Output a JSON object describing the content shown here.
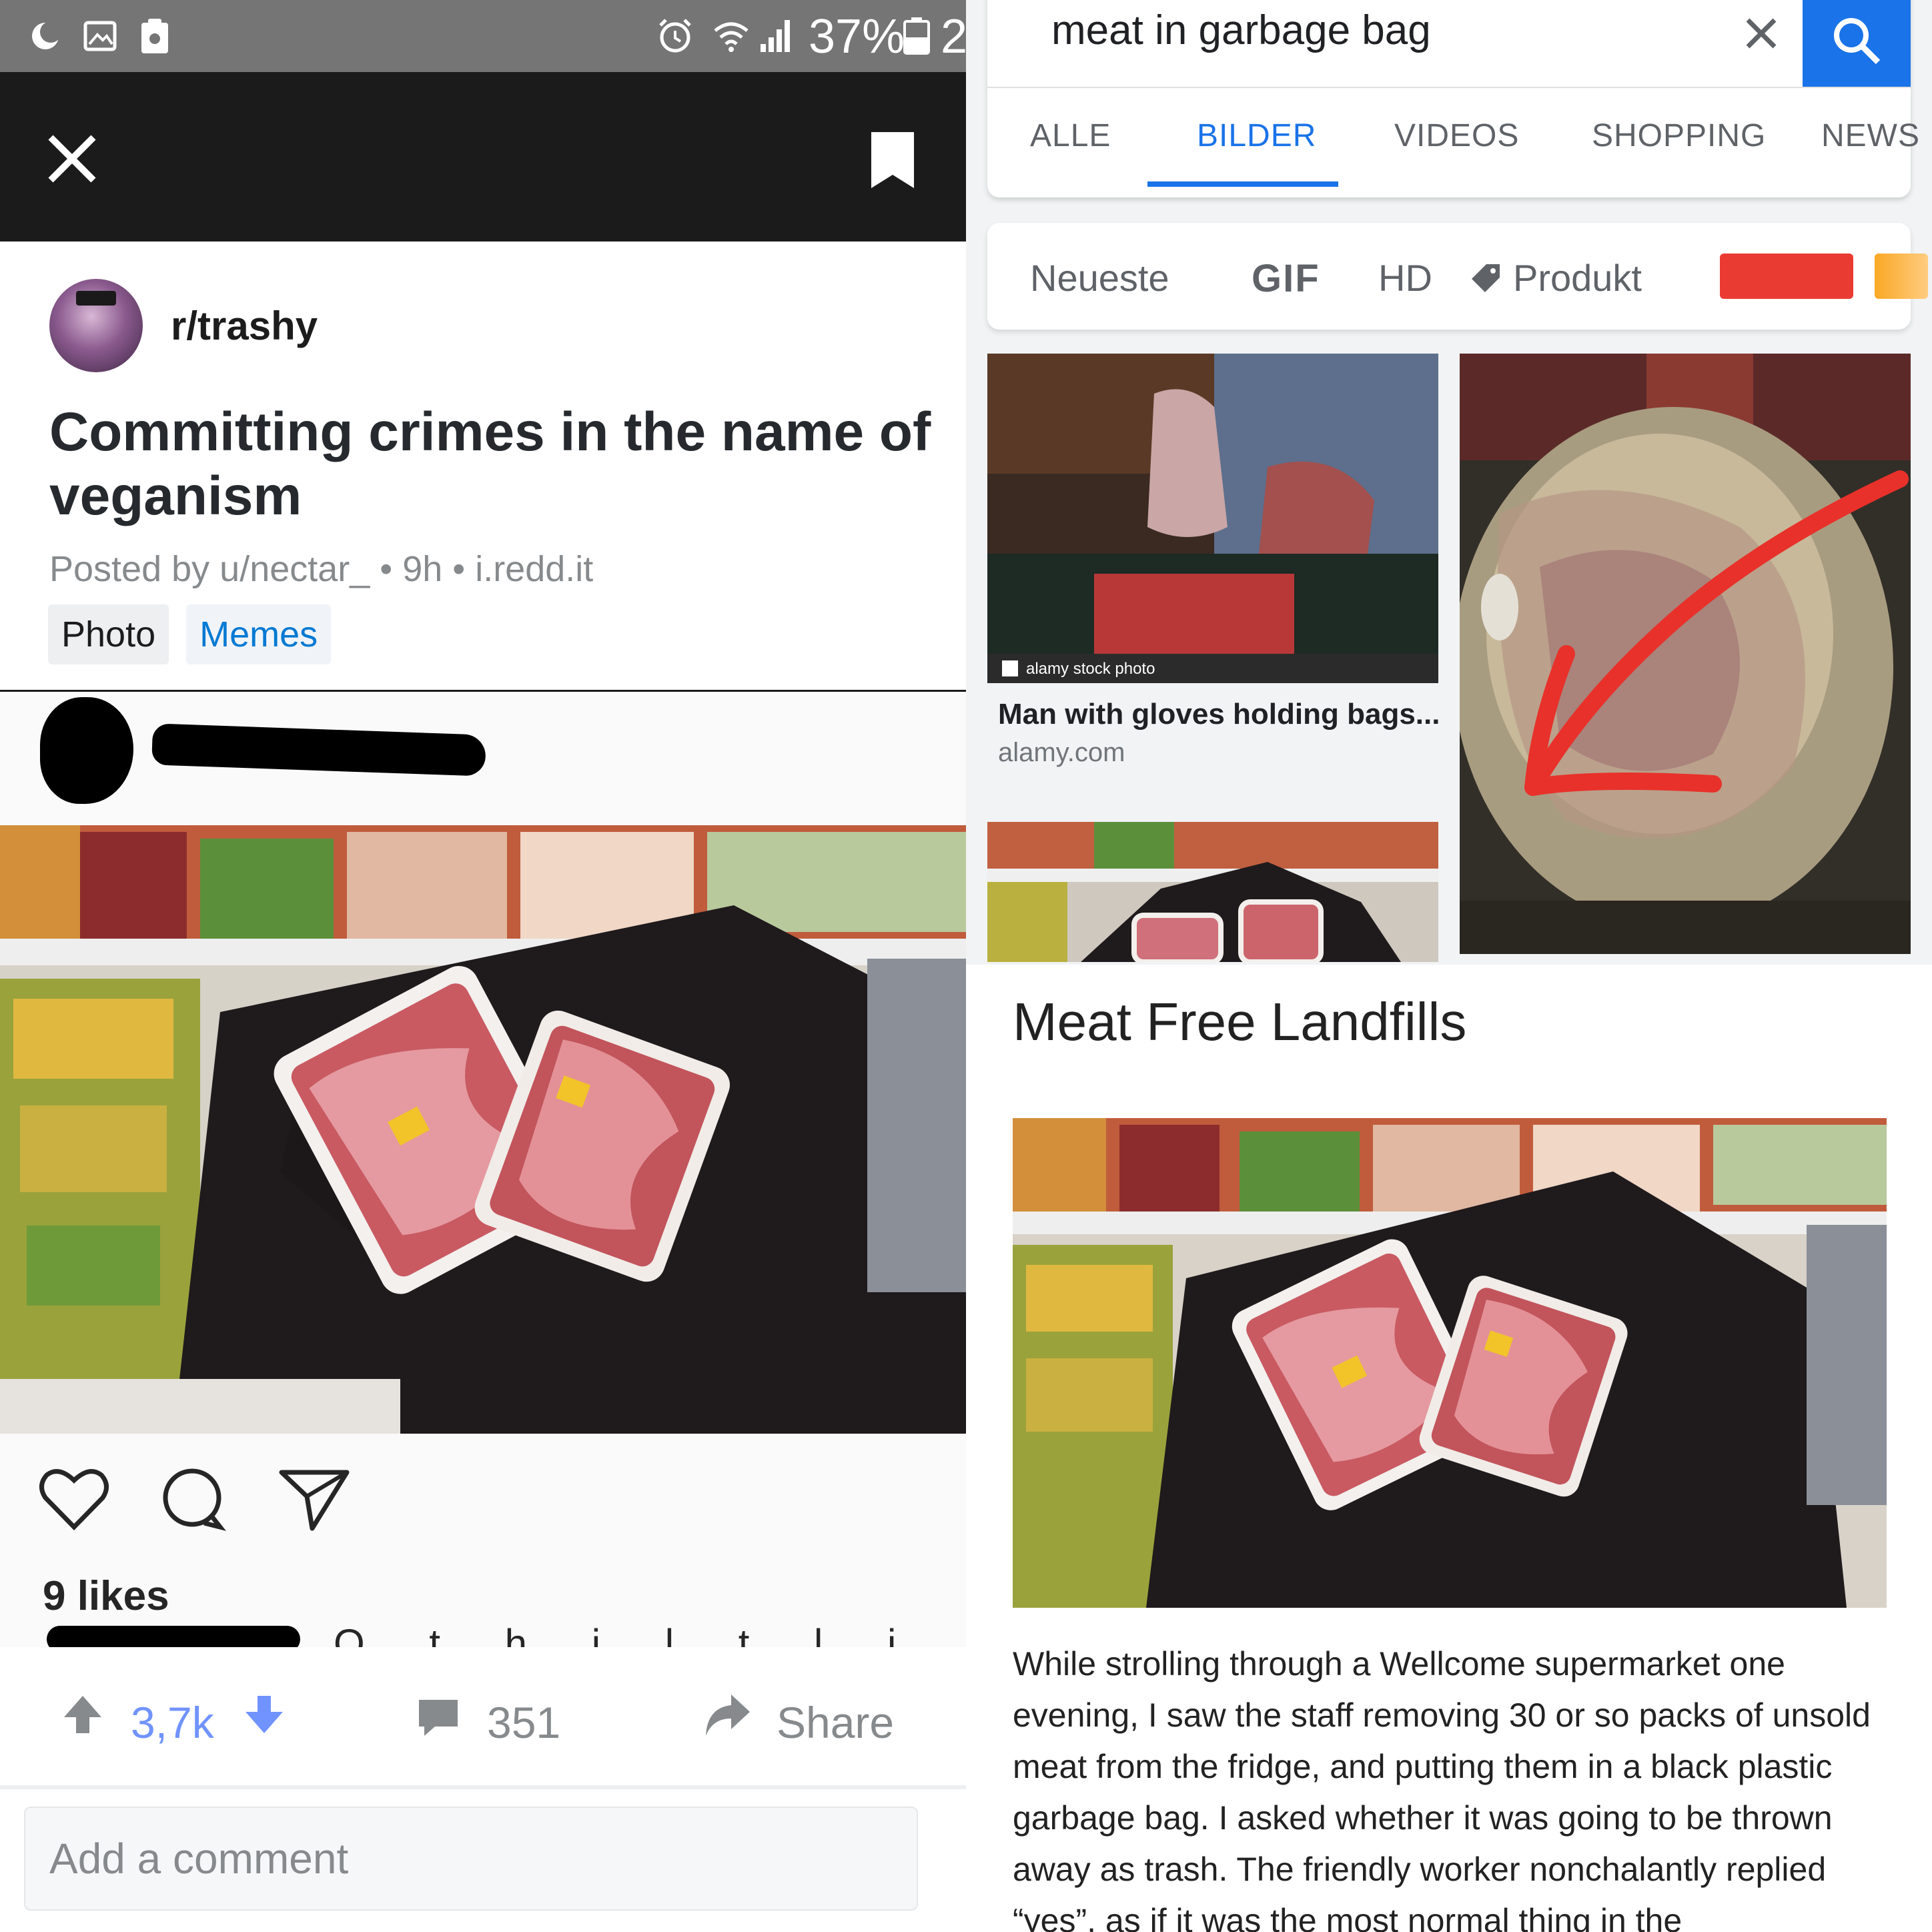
{
  "left": {
    "status_bar": {
      "battery_percent": "37%",
      "time_partial": "2",
      "icons": [
        "moon-icon",
        "image-icon",
        "clipboard-icon",
        "alarm-icon",
        "wifi-icon",
        "signal-icon",
        "battery-icon"
      ]
    },
    "post": {
      "subreddit": "r/trashy",
      "title": "Committing crimes in the name of veganism",
      "meta": "Posted by u/nectar_ • 9h • i.redd.it",
      "flairs": [
        "Photo",
        "Memes"
      ]
    },
    "embedded_instagram": {
      "likes": "9 likes",
      "caption_visible": "O  t h i    l   t   l  i   l   t"
    },
    "actions": {
      "votes": "3,7k",
      "comments": "351",
      "share": "Share"
    },
    "comment_box": {
      "placeholder": "Add a comment"
    }
  },
  "right": {
    "search": {
      "query": "meat in garbage bag"
    },
    "tabs": [
      "ALLE",
      "BILDER",
      "VIDEOS",
      "SHOPPING",
      "NEWS"
    ],
    "active_tab": "BILDER",
    "filters": [
      "Neueste",
      "GIF",
      "HD",
      "Produkt"
    ],
    "color_chips": [
      "#ea3b33",
      "#f9a825"
    ],
    "results": [
      {
        "caption": "Man with gloves holding bags...",
        "source": "alamy.com",
        "watermark": "alamy stock photo"
      }
    ],
    "article": {
      "title": "Meat Free Landfills",
      "body": "While strolling through a Wellcome supermarket one evening, I saw the staff removing 30 or so packs of unsold meat from the fridge, and putting them in a black plastic garbage bag. I asked whether it was going to be thrown away as trash. The friendly worker nonchalantly replied “yes”, as if it was the most normal thing in the"
    },
    "annotation_arrow_color": "#e8312a"
  }
}
